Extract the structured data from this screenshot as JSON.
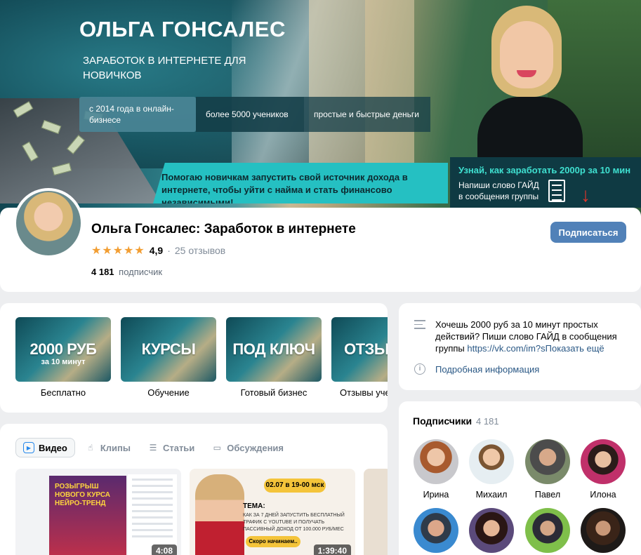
{
  "cover": {
    "title": "ОЛЬГА ГОНСАЛЕС",
    "subtitle": "ЗАРАБОТОК В ИНТЕРНЕТЕ ДЛЯ НОВИЧКОВ",
    "strip": [
      "с 2014 года в онлайн-бизнесе",
      "более 5000 учеников",
      "простые и быстрые деньги"
    ],
    "banner": "Помогаю новичкам запустить свой источник дохода в интернете, чтобы уйти с найма и стать финансово независимыми!",
    "guide_title": "Узнай, как заработать 2000р за 10 мин",
    "guide_text": "Напиши слово ГАЙД в сообщения группы"
  },
  "profile": {
    "name": "Ольга Гонсалес: Заработок в интернете",
    "stars": "★★★★★",
    "rating": "4,9",
    "reviews": "25 отзывов",
    "subs_count": "4 181",
    "subs_label": "подписчик",
    "subscribe_button": "Подписаться"
  },
  "links": [
    {
      "title": "2000 РУБ",
      "sub": "за 10 минут",
      "caption": "Бесплатно"
    },
    {
      "title": "КУРСЫ",
      "sub": "",
      "caption": "Обучение"
    },
    {
      "title": "ПОД КЛЮЧ",
      "sub": "",
      "caption": "Готовый бизнес"
    },
    {
      "title": "ОТЗЫ",
      "sub": "",
      "caption": "Отзывы уче"
    }
  ],
  "info": {
    "text": "Хочешь 2000 руб за 10 минут простых действий? Пиши слово ГАЙД в сообщения группы ",
    "link": "https://vk.com/im?s",
    "show_more": "Показать ещё",
    "details": "Подробная информация"
  },
  "tabs": [
    {
      "label": "Видео",
      "icon": "video-icon"
    },
    {
      "label": "Клипы",
      "icon": "clips-icon"
    },
    {
      "label": "Статьи",
      "icon": "articles-icon"
    },
    {
      "label": "Обсуждения",
      "icon": "discussions-icon"
    }
  ],
  "videos": [
    {
      "duration": "4:08",
      "overlay": "РОЗЫГРЫШ НОВОГО КУРСА НЕЙРО-ТРЕНД"
    },
    {
      "duration": "1:39:40",
      "date": "02.07 в 19-00 мск",
      "tema": "ТЕМА:",
      "desc": "КАК ЗА 7 ДНЕЙ ЗАПУСТИТЬ БЕСПЛАТНЫЙ ТРАФИК С YOUTUBE И ПОЛУЧАТЬ ПАССИВНЫЙ ДОХОД ОТ 100.000 РУБ/МЕС",
      "soon": "Скоро начинаем.."
    }
  ],
  "followers": {
    "title": "Подписчики",
    "count": "4 181",
    "people": [
      "Ирина",
      "Михаил",
      "Павел",
      "Илона"
    ]
  },
  "colors": {
    "accent": "#5181b8",
    "link": "#2a5885",
    "star": "#f29e33",
    "banner": "#25c0c2"
  }
}
